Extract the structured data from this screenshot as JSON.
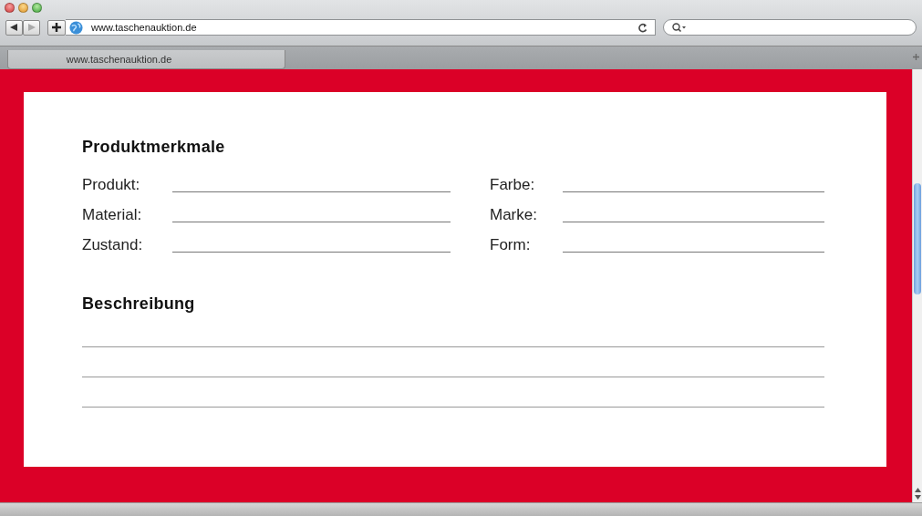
{
  "browser": {
    "address": "www.taschenauktion.de",
    "tabs": [
      {
        "label": "www.taschenauktion.de",
        "selected": true
      }
    ]
  },
  "form": {
    "heading": "Produktmerkmale",
    "fields": [
      {
        "label": "Produkt:"
      },
      {
        "label": "Farbe:"
      },
      {
        "label": "Material:"
      },
      {
        "label": "Marke:"
      },
      {
        "label": "Zustand:"
      },
      {
        "label": "Form:"
      }
    ]
  },
  "description": {
    "heading": "Beschreibung"
  }
}
